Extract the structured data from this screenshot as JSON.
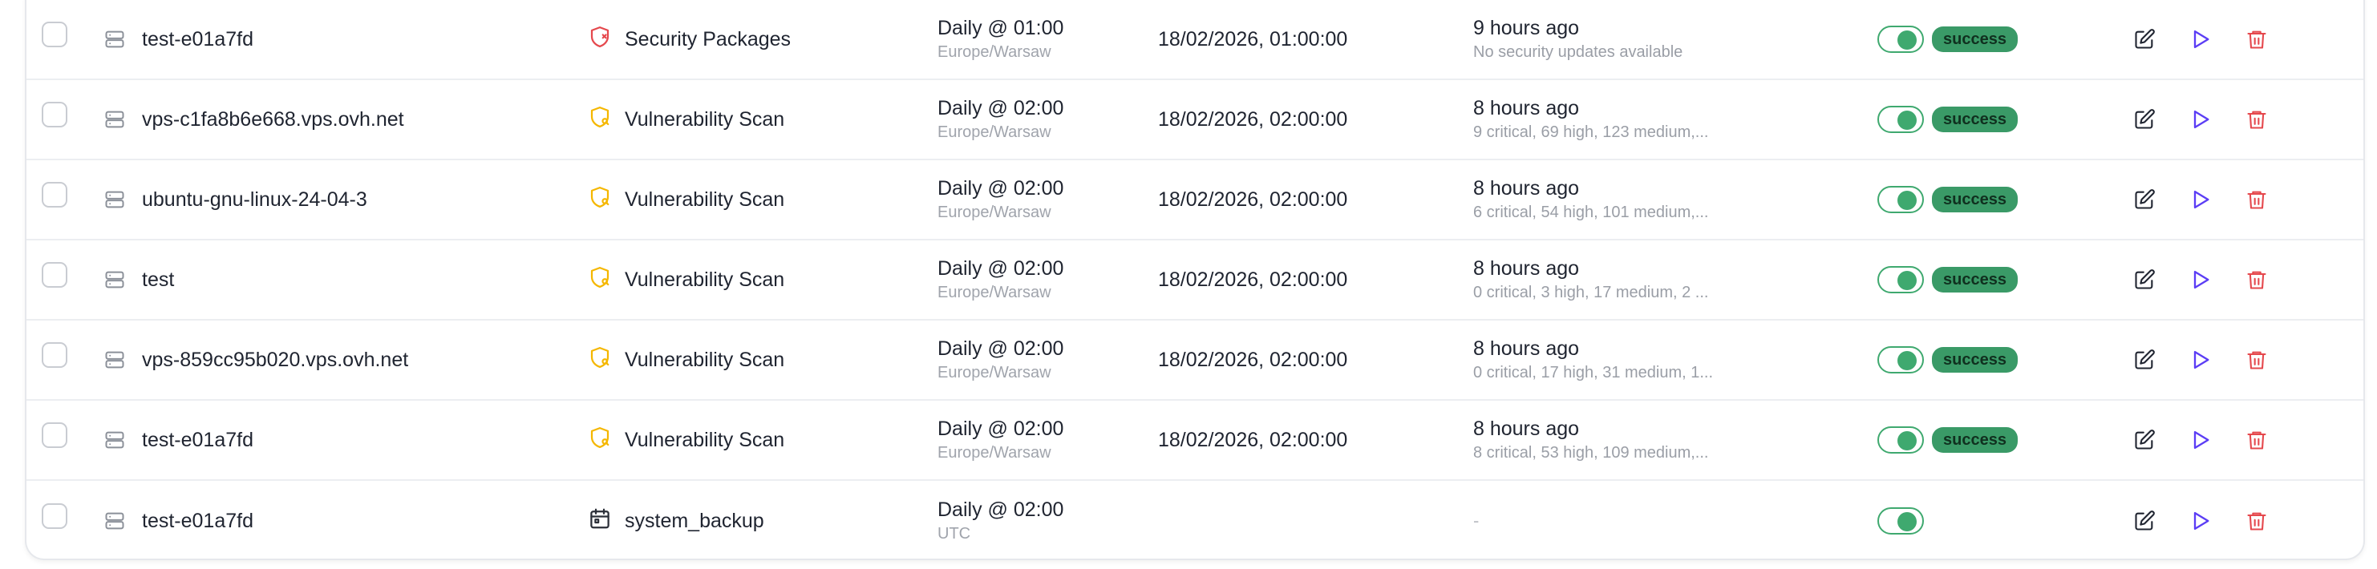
{
  "rows": [
    {
      "host": "test-e01a7fd",
      "task": "Security Packages",
      "task_icon": "shield-alert-icon",
      "task_color": "#e5484d",
      "schedule": "Daily @ 01:00",
      "tz": "Europe/Warsaw",
      "next_run": "18/02/2026, 01:00:00",
      "last_run": "9 hours ago",
      "last_detail": "No security updates available",
      "status": "success",
      "enabled": true
    },
    {
      "host": "vps-c1fa8b6e668.vps.ovh.net",
      "task": "Vulnerability Scan",
      "task_icon": "shield-scan-icon",
      "task_color": "#f5b700",
      "schedule": "Daily @ 02:00",
      "tz": "Europe/Warsaw",
      "next_run": "18/02/2026, 02:00:00",
      "last_run": "8 hours ago",
      "last_detail": "9 critical, 69 high, 123 medium,...",
      "status": "success",
      "enabled": true
    },
    {
      "host": "ubuntu-gnu-linux-24-04-3",
      "task": "Vulnerability Scan",
      "task_icon": "shield-scan-icon",
      "task_color": "#f5b700",
      "schedule": "Daily @ 02:00",
      "tz": "Europe/Warsaw",
      "next_run": "18/02/2026, 02:00:00",
      "last_run": "8 hours ago",
      "last_detail": "6 critical, 54 high, 101 medium,...",
      "status": "success",
      "enabled": true
    },
    {
      "host": "test",
      "task": "Vulnerability Scan",
      "task_icon": "shield-scan-icon",
      "task_color": "#f5b700",
      "schedule": "Daily @ 02:00",
      "tz": "Europe/Warsaw",
      "next_run": "18/02/2026, 02:00:00",
      "last_run": "8 hours ago",
      "last_detail": "0 critical, 3 high, 17 medium, 2 ...",
      "status": "success",
      "enabled": true
    },
    {
      "host": "vps-859cc95b020.vps.ovh.net",
      "task": "Vulnerability Scan",
      "task_icon": "shield-scan-icon",
      "task_color": "#f5b700",
      "schedule": "Daily @ 02:00",
      "tz": "Europe/Warsaw",
      "next_run": "18/02/2026, 02:00:00",
      "last_run": "8 hours ago",
      "last_detail": "0 critical, 17 high, 31 medium, 1...",
      "status": "success",
      "enabled": true
    },
    {
      "host": "test-e01a7fd",
      "task": "Vulnerability Scan",
      "task_icon": "shield-scan-icon",
      "task_color": "#f5b700",
      "schedule": "Daily @ 02:00",
      "tz": "Europe/Warsaw",
      "next_run": "18/02/2026, 02:00:00",
      "last_run": "8 hours ago",
      "last_detail": "8 critical, 53 high, 109 medium,...",
      "status": "success",
      "enabled": true
    },
    {
      "host": "test-e01a7fd",
      "task": "system_backup",
      "task_icon": "calendar-icon",
      "task_color": "#2b2f38",
      "schedule": "Daily @ 02:00",
      "tz": "UTC",
      "next_run": "",
      "last_run": "-",
      "last_detail": "",
      "status": "",
      "enabled": true
    }
  ],
  "colors": {
    "edit": "#1f2430",
    "run": "#5b3df5",
    "delete": "#e5484d",
    "toggle_on": "#3fa96f",
    "badge_success": "#3a9a67"
  }
}
